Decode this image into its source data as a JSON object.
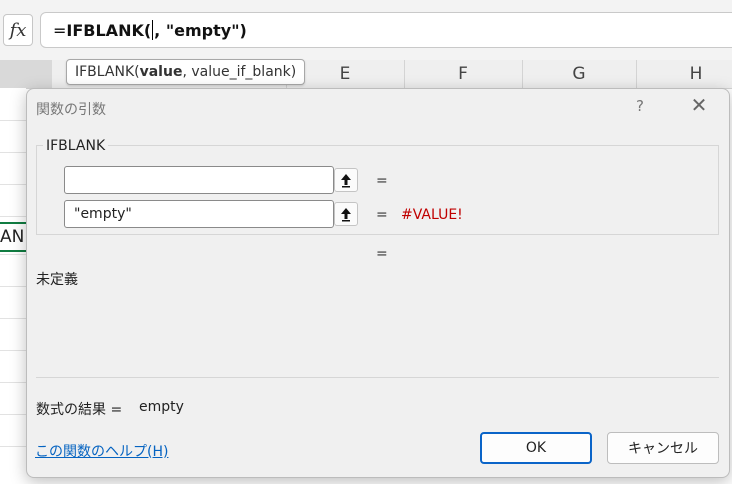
{
  "formula_bar": {
    "fx_label": "fx",
    "formula_prefix": "=",
    "formula_function": "IFBLANK(",
    "formula_rest": ", \"empty\")"
  },
  "tooltip": {
    "fn": "IFBLANK(",
    "arg1": "value",
    "rest": ", value_if_blank)"
  },
  "columns": [
    "E",
    "F",
    "G",
    "H"
  ],
  "cell_fragment": "AN",
  "dialog": {
    "title": "関数の引数",
    "help_symbol": "?",
    "close_symbol": "✕",
    "function_name": "IFBLANK",
    "args": [
      {
        "value": "",
        "equals": "=",
        "result": ""
      },
      {
        "value": "\"empty\"",
        "equals": "=",
        "result": "#VALUE!"
      }
    ],
    "overall_equals": "=",
    "description": "未定義",
    "result_label": "数式の結果 =",
    "result_value": "empty",
    "help_link": "この関数のヘルプ(H)",
    "ok_label": "OK",
    "cancel_label": "キャンセル"
  },
  "colors": {
    "accent": "#0a64c8",
    "error": "#c00000",
    "link": "#0563c1",
    "selection": "#107c41"
  },
  "icons": {
    "ref_button": "collapse-arrow-up-icon",
    "close": "close-icon"
  }
}
